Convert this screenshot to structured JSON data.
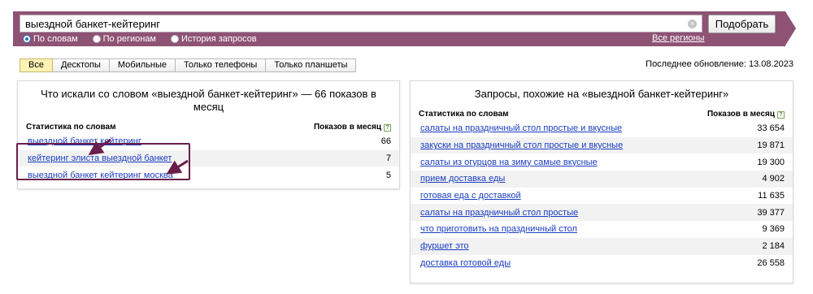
{
  "search": {
    "query": "выездной банкет-кейтеринг",
    "submit_label": "Подобрать",
    "clear_icon": "×",
    "modes": [
      {
        "label": "По словам",
        "checked": true
      },
      {
        "label": "По регионам",
        "checked": false
      },
      {
        "label": "История запросов",
        "checked": false
      }
    ],
    "all_regions_label": "Все регионы"
  },
  "tabs": [
    {
      "label": "Все",
      "active": true
    },
    {
      "label": "Десктопы",
      "active": false
    },
    {
      "label": "Мобильные",
      "active": false
    },
    {
      "label": "Только телефоны",
      "active": false
    },
    {
      "label": "Только планшеты",
      "active": false
    }
  ],
  "last_update": "Последнее обновление: 13.08.2023",
  "left_panel": {
    "title": "Что искали со словом «выездной банкет-кейтеринг» — 66 показов в месяц",
    "col_left": "Статистика по словам",
    "col_right": "Показов в месяц",
    "help_icon": "?",
    "rows": [
      {
        "query": "выездной банкет кейтеринг",
        "count": "66"
      },
      {
        "query": "кейтеринг элиста выездной банкет",
        "count": "7"
      },
      {
        "query": "выездной банкет кейтеринг москва",
        "count": "5"
      }
    ]
  },
  "right_panel": {
    "title": "Запросы, похожие на «выездной банкет-кейтеринг»",
    "col_left": "Статистика по словам",
    "col_right": "Показов в месяц",
    "help_icon": "?",
    "rows": [
      {
        "query": "салаты на праздничный стол простые и вкусные",
        "count": "33 654"
      },
      {
        "query": "закуски на праздничный стол простые и вкусные",
        "count": "19 871"
      },
      {
        "query": "салаты из огурцов на зиму самые вкусные",
        "count": "19 300"
      },
      {
        "query": "прием доставка еды",
        "count": "4 902"
      },
      {
        "query": "готовая еда с доставкой",
        "count": "11 635"
      },
      {
        "query": "салаты на праздничный стол простые",
        "count": "39 377"
      },
      {
        "query": "что приготовить на праздничный стол",
        "count": "9 369"
      },
      {
        "query": "фуршет это",
        "count": "2 184"
      },
      {
        "query": "доставка готовой еды",
        "count": "26 558"
      }
    ]
  },
  "colors": {
    "banner": "#8e5374",
    "annotation": "#6a1e4b",
    "link": "#1a3dc1",
    "active_tab": "#fff2b5"
  }
}
